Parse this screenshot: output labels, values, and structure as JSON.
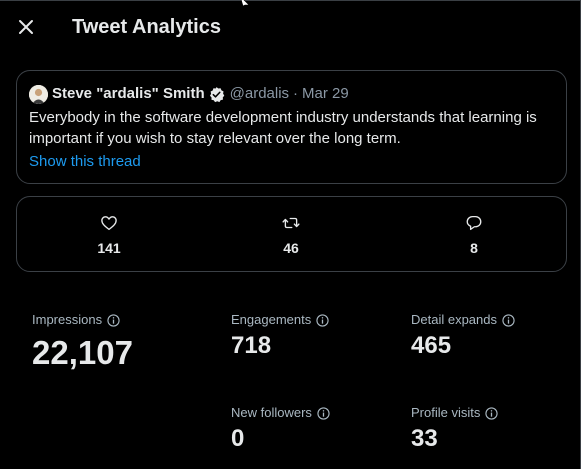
{
  "header": {
    "title": "Tweet Analytics"
  },
  "tweet": {
    "author_name": "Steve \"ardalis\" Smith",
    "handle": "@ardalis",
    "separator": "·",
    "date": "Mar 29",
    "text": "Everybody in the software development industry understands that learning is important if you wish to stay relevant over the long term.",
    "thread_link": "Show this thread"
  },
  "engagement": {
    "likes": "141",
    "retweets": "46",
    "replies": "8"
  },
  "stats": {
    "impressions": {
      "label": "Impressions",
      "value": "22,107"
    },
    "engagements": {
      "label": "Engagements",
      "value": "718"
    },
    "detail_expands": {
      "label": "Detail expands",
      "value": "465"
    },
    "new_followers": {
      "label": "New followers",
      "value": "0"
    },
    "profile_visits": {
      "label": "Profile visits",
      "value": "33"
    }
  },
  "colors": {
    "background": "#000000",
    "text_primary": "#e7e9ea",
    "text_secondary": "#8b98a5",
    "link": "#1d9bf0",
    "verified": "#e7e9ea",
    "border": "#3b4046"
  },
  "icons": {
    "close": "close-icon",
    "verified": "verified-badge-icon",
    "like": "heart-icon",
    "retweet": "retweet-icon",
    "reply": "reply-icon",
    "info": "info-icon"
  }
}
